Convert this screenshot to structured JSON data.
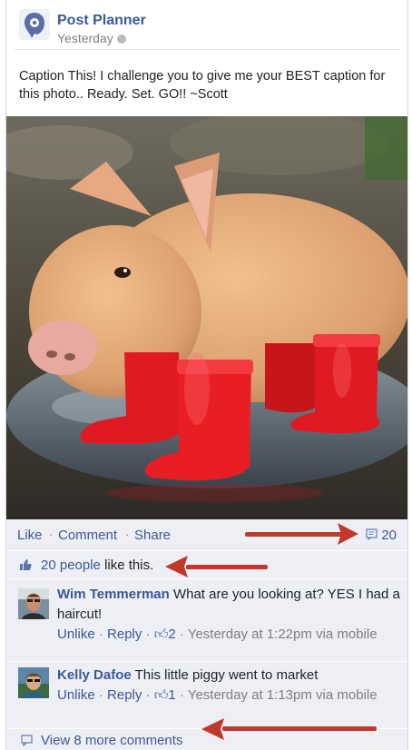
{
  "post": {
    "page_name": "Post Planner",
    "timestamp": "Yesterday",
    "caption": "Caption This! I challenge you to give me your BEST caption for this photo.. Ready. Set. GO!! ~Scott"
  },
  "actions": {
    "like": "Like",
    "comment": "Comment",
    "share": "Share",
    "comment_count": "20"
  },
  "likes": {
    "people": "20 people",
    "suffix": "like this."
  },
  "comments": [
    {
      "name": "Wim Temmerman",
      "text": "What are you looking at? YES I had a haircut!",
      "unlike": "Unlike",
      "reply": "Reply",
      "likes": "2",
      "time": "Yesterday at 1:22pm via mobile"
    },
    {
      "name": "Kelly Dafoe",
      "text": "This little piggy went to market",
      "unlike": "Unlike",
      "reply": "Reply",
      "likes": "1",
      "time": "Yesterday at 1:13pm via mobile"
    }
  ],
  "view_more": "View 8 more comments",
  "colors": {
    "link": "#3b5998",
    "panel": "#edeff4",
    "arrow": "#c0392b",
    "boots": "#e01a22"
  }
}
